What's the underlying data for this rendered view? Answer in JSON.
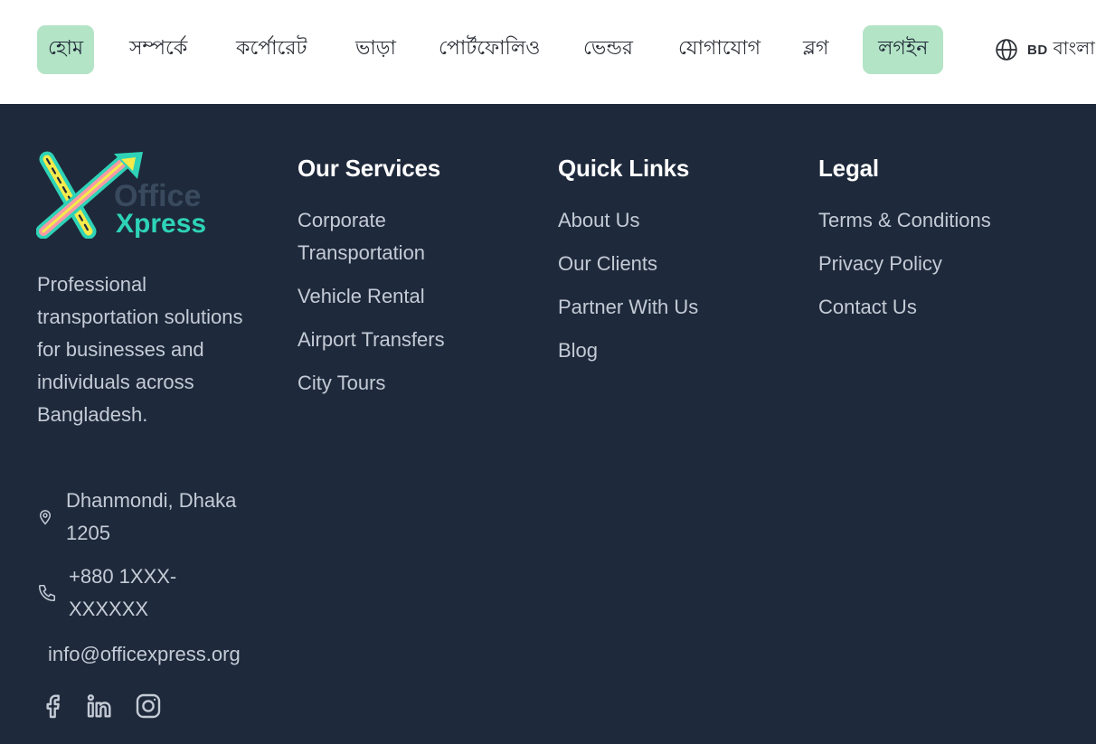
{
  "nav": {
    "items": [
      {
        "label": "হোম",
        "active": true
      },
      {
        "label": "সম্পর্কে"
      },
      {
        "label": "কর্পোরেট"
      },
      {
        "label": "ভাড়া"
      },
      {
        "label": "পোর্টফোলিও"
      },
      {
        "label": "ভেন্ডর"
      },
      {
        "label": "যোগাযোগ"
      },
      {
        "label": "ব্লগ"
      },
      {
        "label": "লগইন",
        "highlight": true
      }
    ],
    "language": {
      "icon": "globe-icon",
      "flag": "BD",
      "label": "বাংলা"
    }
  },
  "footer": {
    "logo": {
      "word1": "Office",
      "word2": "Xpress"
    },
    "description": "Professional transportation solutions for businesses and individuals across Bangladesh.",
    "address": "Dhanmondi, Dhaka 1205",
    "phone": "+880 1XXX-XXXXXX",
    "email": "info@officexpress.org",
    "social": [
      "facebook-icon",
      "linkedin-icon",
      "instagram-icon"
    ],
    "services": {
      "title": "Our Services",
      "items": [
        "Corporate Transportation",
        "Vehicle Rental",
        "Airport Transfers",
        "City Tours"
      ]
    },
    "quick_links": {
      "title": "Quick Links",
      "items": [
        "About Us",
        "Our Clients",
        "Partner With Us",
        "Blog"
      ]
    },
    "legal": {
      "title": "Legal",
      "items": [
        "Terms & Conditions",
        "Privacy Policy",
        "Contact Us"
      ]
    }
  },
  "colors": {
    "footer_bg": "#1e293b",
    "pill_bg": "#b3e4c6",
    "brand_teal": "#2ed3b7",
    "brand_yellow": "#f5ea4a",
    "brand_pink": "#f59aa6"
  }
}
